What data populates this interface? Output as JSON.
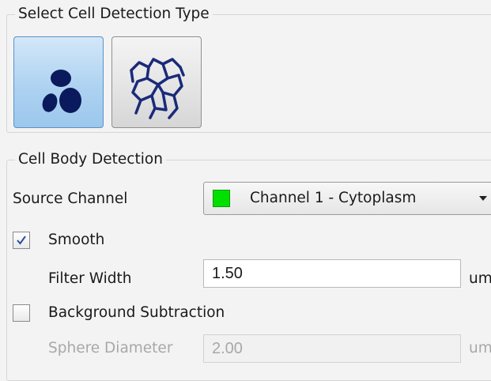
{
  "detection_type": {
    "legend": "Select Cell Detection Type",
    "options": [
      {
        "id": "cell-body",
        "icon": "cell-body-icon",
        "selected": true
      },
      {
        "id": "membrane",
        "icon": "membrane-network-icon",
        "selected": false
      }
    ]
  },
  "cell_body_detection": {
    "legend": "Cell Body Detection",
    "source_channel": {
      "label": "Source Channel",
      "value": "Channel 1 - Cytoplasm",
      "swatch_color": "#00e000"
    },
    "smooth": {
      "label": "Smooth",
      "checked": true,
      "filter_width": {
        "label": "Filter Width",
        "value": "1.50",
        "unit": "um"
      }
    },
    "background_subtraction": {
      "label": "Background Subtraction",
      "checked": false,
      "sphere_diameter": {
        "label": "Sphere Diameter",
        "value": "2.00",
        "unit": "um",
        "enabled": false
      }
    }
  },
  "colors": {
    "selected_button": "#aed2f1",
    "accent_border": "#5a93c8",
    "icon_fill": "#0a1a5c"
  }
}
